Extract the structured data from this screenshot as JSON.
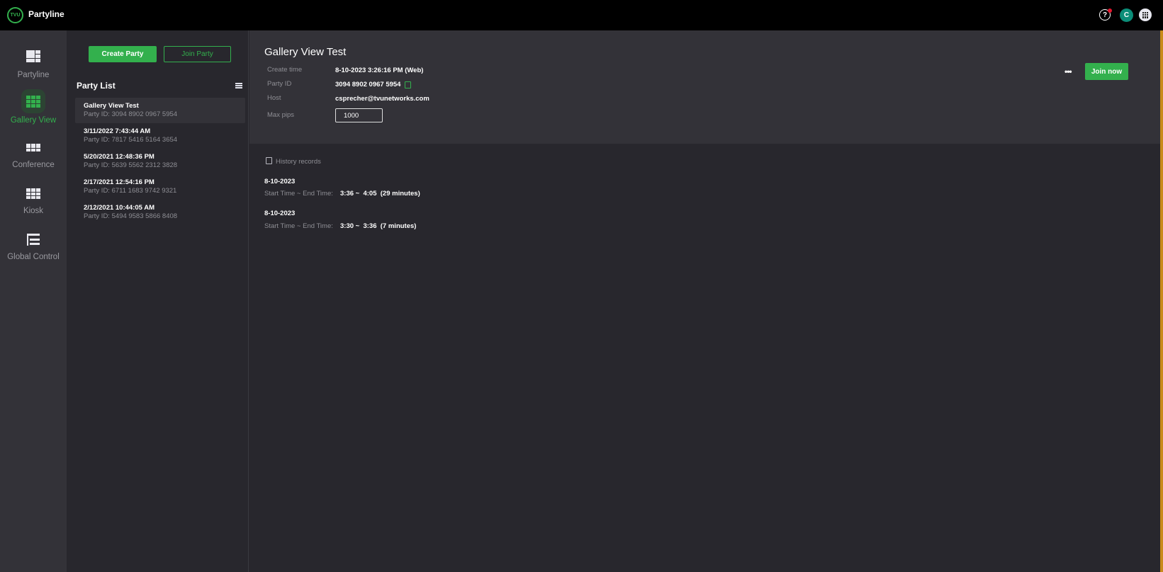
{
  "app": {
    "logo_text": "TVU",
    "title": "Partyline"
  },
  "topbar": {
    "help_icon": "?",
    "avatar_letter": "C"
  },
  "sidebar": {
    "items": [
      {
        "label": "Partyline",
        "icon": "partyline-layout-icon",
        "active": false
      },
      {
        "label": "Gallery View",
        "icon": "gallery-grid-icon",
        "active": true
      },
      {
        "label": "Conference",
        "icon": "conference-layout-icon",
        "active": false
      },
      {
        "label": "Kiosk",
        "icon": "kiosk-layout-icon",
        "active": false
      },
      {
        "label": "Global Control",
        "icon": "global-control-icon",
        "active": false
      }
    ]
  },
  "list_panel": {
    "create_label": "Create Party",
    "join_label": "Join Party",
    "title": "Party List",
    "parties": [
      {
        "name": "Gallery View Test",
        "id": "Party ID: 3094 8902 0967 5954",
        "selected": true
      },
      {
        "name": "3/11/2022 7:43:44 AM",
        "id": "Party ID: 7817 5416 5164 3654",
        "selected": false
      },
      {
        "name": "5/20/2021 12:48:36 PM",
        "id": "Party ID: 5639 5562 2312 3828",
        "selected": false
      },
      {
        "name": "2/17/2021 12:54:16 PM",
        "id": "Party ID: 6711 1683 9742 9321",
        "selected": false
      },
      {
        "name": "2/12/2021 10:44:05 AM",
        "id": "Party ID: 5494 9583 5866 8408",
        "selected": false
      }
    ]
  },
  "detail": {
    "title": "Gallery View Test",
    "fields": {
      "create_time_label": "Create time",
      "create_time_value": "8-10-2023 3:26:16 PM (Web)",
      "party_id_label": "Party ID",
      "party_id_value": "3094 8902 0967 5954",
      "host_label": "Host",
      "host_value": "csprecher@tvunetworks.com",
      "max_pips_label": "Max pips",
      "max_pips_value": "1000"
    },
    "more_label": "•••",
    "join_now_label": "Join now"
  },
  "history": {
    "title": "History records",
    "records": [
      {
        "date": "8-10-2023",
        "label": "Start Time ~ End Time:",
        "time": "3:36 ~  4:05  (29 minutes)"
      },
      {
        "date": "8-10-2023",
        "label": "Start Time ~ End Time:",
        "time": "3:30 ~  3:36  (7 minutes)"
      }
    ]
  },
  "colors": {
    "accent": "#33b04d",
    "topbar": "#000000",
    "sidebar": "#333238",
    "background": "#28272d",
    "avatar": "#0b8d78",
    "notification": "#e6152c"
  }
}
